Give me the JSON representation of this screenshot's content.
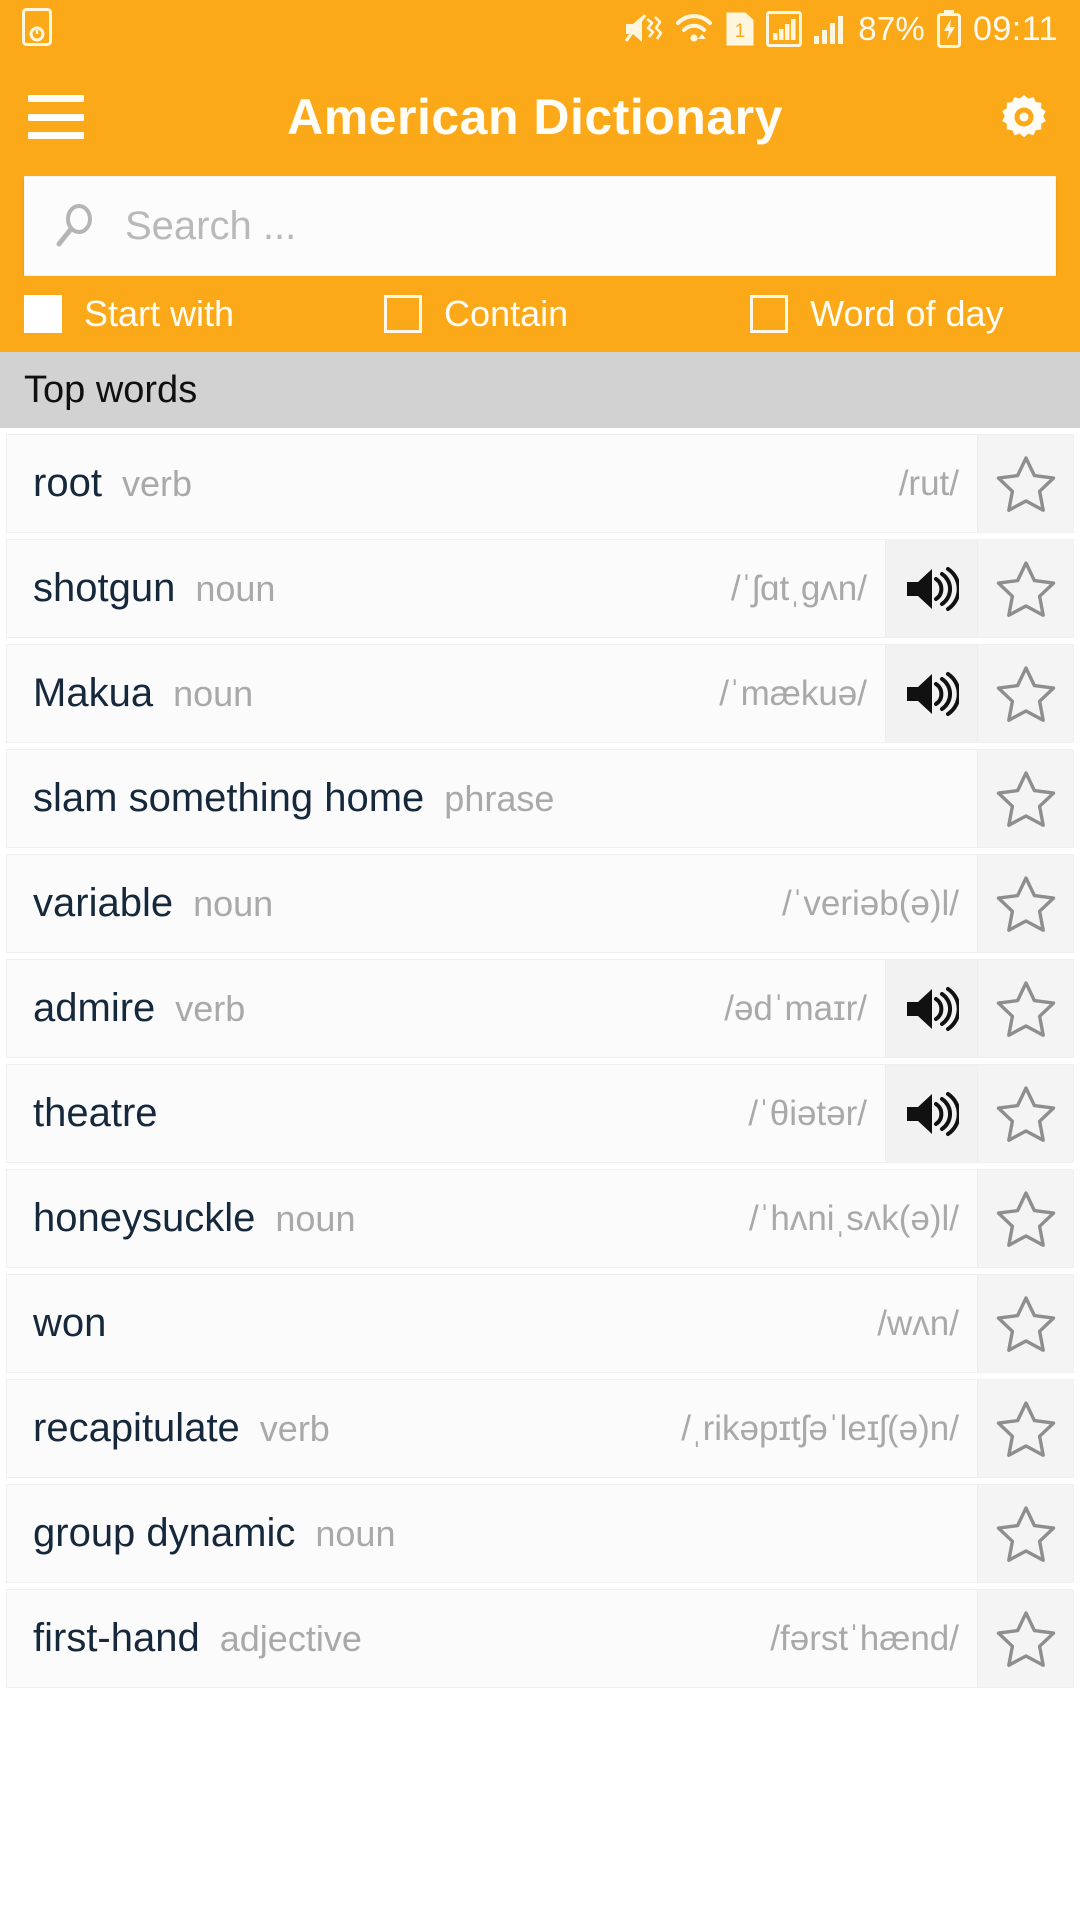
{
  "status_bar": {
    "icons": [
      "sound-off-vibrate-icon",
      "wifi-icon",
      "sim-1-icon",
      "signal-boxed-icon",
      "signal-bars-icon"
    ],
    "sim_label": "1",
    "battery_percent": "87%",
    "battery_state": "charging",
    "time": "09:11",
    "left_icon": "device-clock-icon"
  },
  "app_bar": {
    "menu_icon": "hamburger-menu-icon",
    "title": "American Dictionary",
    "settings_icon": "gear-icon"
  },
  "search": {
    "icon": "search-icon",
    "value": "",
    "placeholder": "Search ..."
  },
  "options": [
    {
      "label": "Start with",
      "checked": true
    },
    {
      "label": "Contain",
      "checked": false
    },
    {
      "label": "Word of day",
      "checked": false
    }
  ],
  "section": {
    "title": "Top words"
  },
  "colors": {
    "accent": "#FBA919",
    "section_bg": "#d2d2d2",
    "word": "#16283c",
    "muted": "#a9a9a9",
    "row_bg": "#fbfbfb"
  },
  "words": [
    {
      "word": "root",
      "pos": "verb",
      "phonetic": "/rut/",
      "audio": false,
      "starred": false
    },
    {
      "word": "shotgun",
      "pos": "noun",
      "phonetic": "/ˈʃɑtˌɡʌn/",
      "audio": true,
      "starred": false
    },
    {
      "word": "Makua",
      "pos": "noun",
      "phonetic": "/ˈmækuə/",
      "audio": true,
      "starred": false
    },
    {
      "word": "slam something home",
      "pos": "phrase",
      "phonetic": "",
      "audio": false,
      "starred": false
    },
    {
      "word": "variable",
      "pos": "noun",
      "phonetic": "/ˈveriəb(ə)l/",
      "audio": false,
      "starred": false
    },
    {
      "word": "admire",
      "pos": "verb",
      "phonetic": "/ədˈmaɪr/",
      "audio": true,
      "starred": false
    },
    {
      "word": "theatre",
      "pos": "",
      "phonetic": "/ˈθiətər/",
      "audio": true,
      "starred": false
    },
    {
      "word": "honeysuckle",
      "pos": "noun",
      "phonetic": "/ˈhʌniˌsʌk(ə)l/",
      "audio": false,
      "starred": false
    },
    {
      "word": "won",
      "pos": "",
      "phonetic": "/wʌn/",
      "audio": false,
      "starred": false
    },
    {
      "word": "recapitulate",
      "pos": "verb",
      "phonetic": "/ˌrikəpɪtʃəˈleɪʃ(ə)n/",
      "audio": false,
      "starred": false
    },
    {
      "word": "group dynamic",
      "pos": "noun",
      "phonetic": "",
      "audio": false,
      "starred": false
    },
    {
      "word": "first-hand",
      "pos": "adjective",
      "phonetic": "/fərstˈhænd/",
      "audio": false,
      "starred": false
    }
  ]
}
